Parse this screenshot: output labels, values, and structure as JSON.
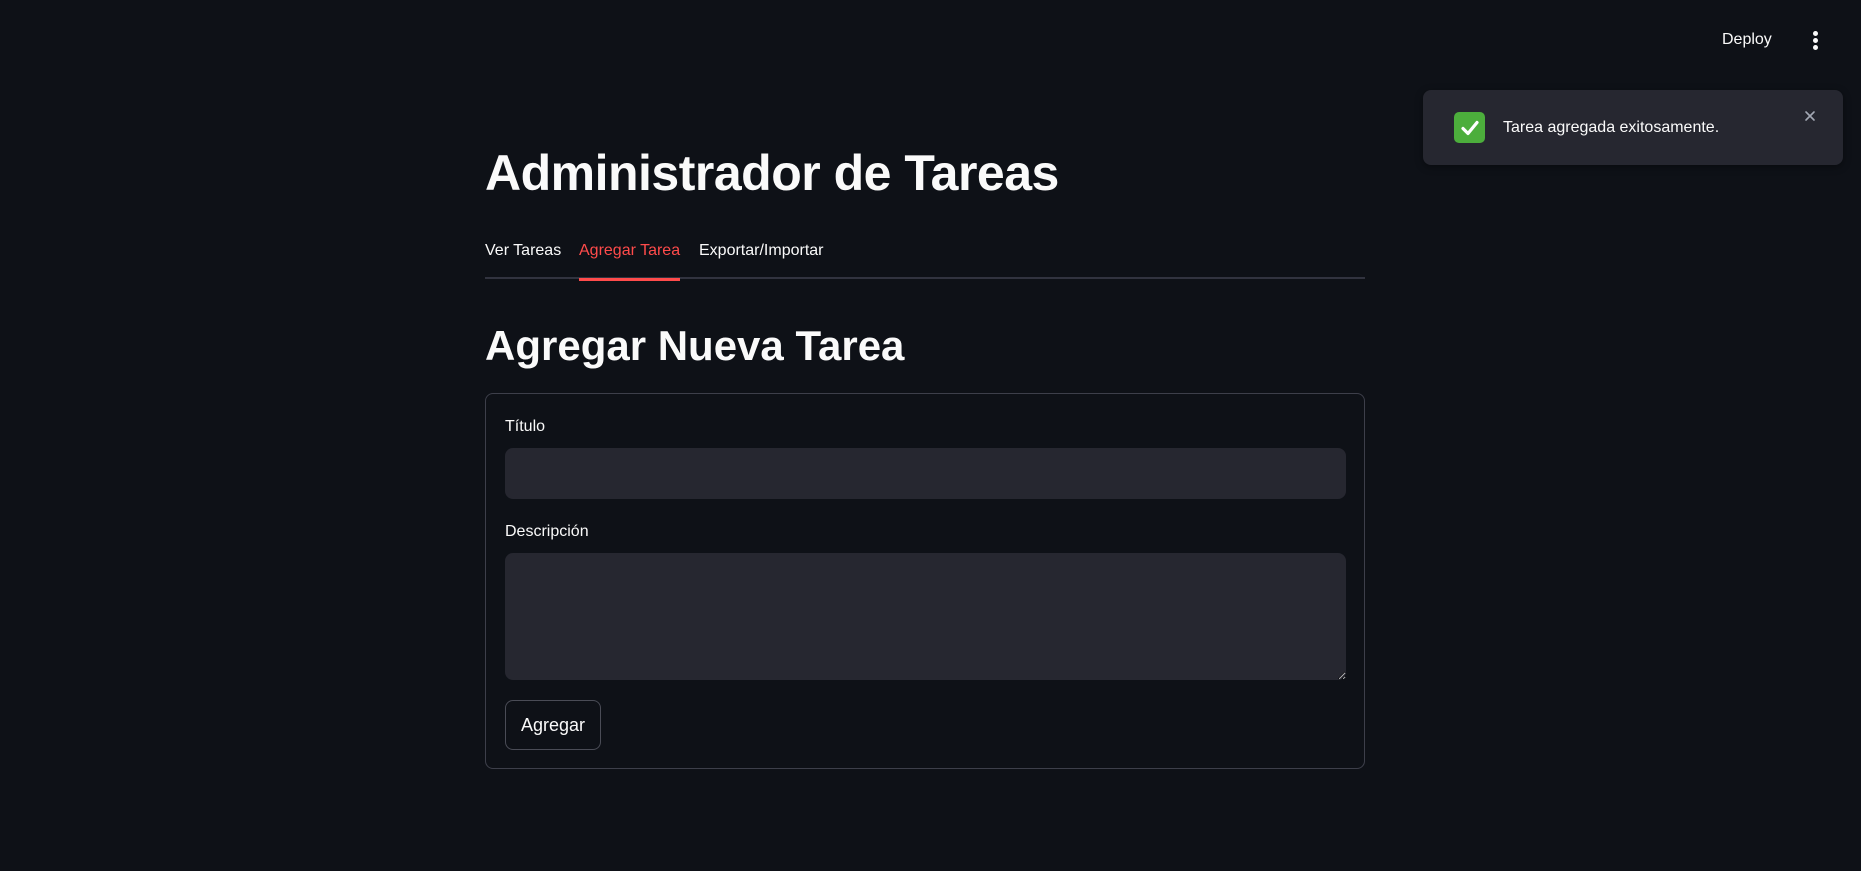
{
  "header": {
    "deploy_label": "Deploy",
    "menu_icon": "more-vertical-icon"
  },
  "toast": {
    "icon": "check-mark-icon",
    "icon_color": "#4cae3c",
    "message": "Tarea agregada exitosamente.",
    "close_icon": "close-icon"
  },
  "main": {
    "title": "Administrador de Tareas",
    "tabs": [
      {
        "label": "Ver Tareas",
        "active": false
      },
      {
        "label": "Agregar Tarea",
        "active": true
      },
      {
        "label": "Exportar/Importar",
        "active": false
      }
    ],
    "subtitle": "Agregar Nueva Tarea",
    "form": {
      "title_label": "Título",
      "title_value": "",
      "description_label": "Descripción",
      "description_value": "",
      "submit_label": "Agregar"
    }
  },
  "colors": {
    "background": "#0e1117",
    "accent": "#ff4b4b",
    "surface": "#262730",
    "text": "#fafafa"
  }
}
